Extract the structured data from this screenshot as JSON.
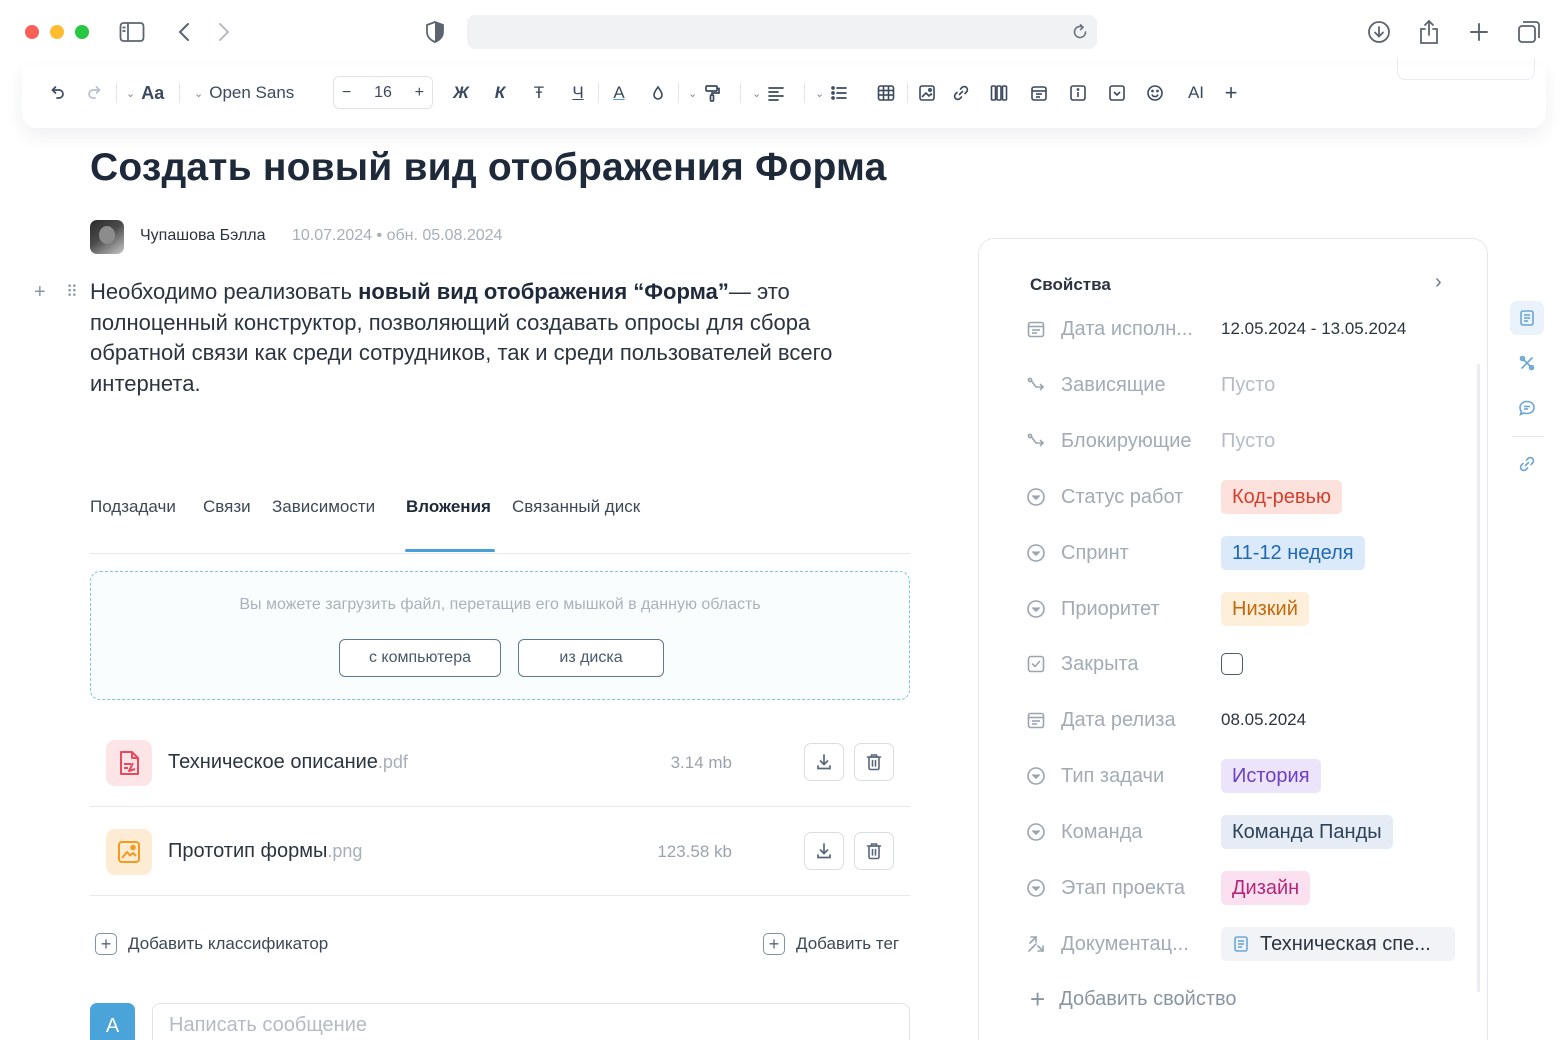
{
  "browser": {
    "url": "",
    "icons": [
      "sidebar-icon",
      "back-icon",
      "forward-icon",
      "shield-icon",
      "reload-icon",
      "download-icon",
      "share-icon",
      "new-tab-icon",
      "tabs-overview-icon"
    ]
  },
  "toolbar": {
    "font_style_label": "Aa",
    "font_name": "Open Sans",
    "font_size": "16",
    "size_minus": "−",
    "size_plus": "+",
    "bold": "Ж",
    "italic": "К",
    "strike": "Ŧ",
    "underline": "Ч",
    "text_color": "A",
    "ai_label": "AI",
    "more": "+"
  },
  "task": {
    "title": "Создать новый вид отображения Форма",
    "author": "Чупашова Бэлла",
    "dates": "10.07.2024 • обн. 05.08.2024",
    "description_pre": "Необходимо реализовать ",
    "description_bold": "новый вид отображения “Форма”",
    "description_post": "— это полноценный конструктор, позволяющий создавать опросы для сбора обратной связи как среди сотрудников, так и среди пользователей всего интернета."
  },
  "tabs": [
    {
      "label": "Подзадачи"
    },
    {
      "label": "Связи"
    },
    {
      "label": "Зависимости"
    },
    {
      "label": "Вложения",
      "active": true
    },
    {
      "label": "Связанный диск"
    }
  ],
  "dropzone": {
    "hint": "Вы можете загрузить файл, перетащив его мышкой в данную область",
    "from_computer": "с компьютера",
    "from_disk": "из диска"
  },
  "attachments": [
    {
      "name": "Техническое описание",
      "ext": ".pdf",
      "size": "3.14 mb",
      "type": "pdf"
    },
    {
      "name": "Прототип формы",
      "ext": ".png",
      "size": "123.58 kb",
      "type": "image"
    }
  ],
  "actions": {
    "add_classifier": "Добавить классификатор",
    "add_tag": "Добавить тег"
  },
  "comment": {
    "avatar_letter": "A",
    "placeholder": "Написать сообщение"
  },
  "properties": {
    "title": "Свойства",
    "items": [
      {
        "label": "Дата исполн...",
        "value": "12.05.2024 - 13.05.2024",
        "icon": "calendar-icon"
      },
      {
        "label": "Зависящие",
        "value": "Пусто",
        "icon": "dependency-icon",
        "empty": true
      },
      {
        "label": "Блокирующие",
        "value": "Пусто",
        "icon": "dependency-icon",
        "empty": true
      },
      {
        "label": "Статус работ",
        "value": "Код-ревью",
        "icon": "select-icon",
        "bg": "#fde1dc",
        "fg": "#d2412e"
      },
      {
        "label": "Спринт",
        "value": "11-12 неделя",
        "icon": "select-icon",
        "bg": "#dbeafb",
        "fg": "#2068b3"
      },
      {
        "label": "Приоритет",
        "value": "Низкий",
        "icon": "select-icon",
        "bg": "#fdefd9",
        "fg": "#c26a10"
      },
      {
        "label": "Закрыта",
        "value": "",
        "icon": "checkbox-icon",
        "checkbox": true
      },
      {
        "label": "Дата релиза",
        "value": "08.05.2024",
        "icon": "calendar-icon"
      },
      {
        "label": "Тип задачи",
        "value": "История",
        "icon": "select-icon",
        "bg": "#ece4fb",
        "fg": "#6c3fc4"
      },
      {
        "label": "Команда",
        "value": "Команда Панды",
        "icon": "select-icon",
        "bg": "#e5ecf5",
        "fg": "#2e4358"
      },
      {
        "label": "Этап проекта",
        "value": "Дизайн",
        "icon": "select-icon",
        "bg": "#fbe1ef",
        "fg": "#b3287c"
      },
      {
        "label": "Документац...",
        "value": "Техническая спе...",
        "icon": "link-arrow-icon",
        "doc": true
      }
    ],
    "add_property": "Добавить свойство"
  }
}
